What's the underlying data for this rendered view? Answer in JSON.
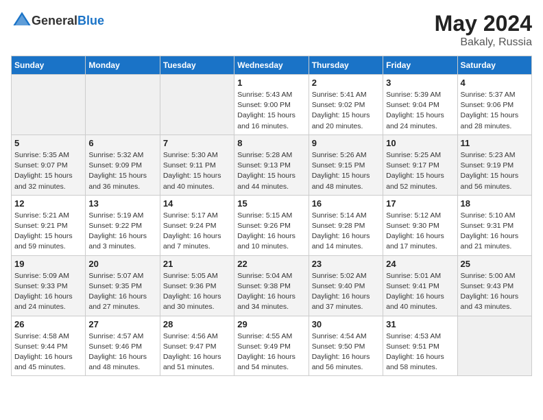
{
  "header": {
    "logo_general": "General",
    "logo_blue": "Blue",
    "month_year": "May 2024",
    "location": "Bakaly, Russia"
  },
  "weekdays": [
    "Sunday",
    "Monday",
    "Tuesday",
    "Wednesday",
    "Thursday",
    "Friday",
    "Saturday"
  ],
  "weeks": [
    [
      {
        "day": "",
        "info": ""
      },
      {
        "day": "",
        "info": ""
      },
      {
        "day": "",
        "info": ""
      },
      {
        "day": "1",
        "info": "Sunrise: 5:43 AM\nSunset: 9:00 PM\nDaylight: 15 hours\nand 16 minutes."
      },
      {
        "day": "2",
        "info": "Sunrise: 5:41 AM\nSunset: 9:02 PM\nDaylight: 15 hours\nand 20 minutes."
      },
      {
        "day": "3",
        "info": "Sunrise: 5:39 AM\nSunset: 9:04 PM\nDaylight: 15 hours\nand 24 minutes."
      },
      {
        "day": "4",
        "info": "Sunrise: 5:37 AM\nSunset: 9:06 PM\nDaylight: 15 hours\nand 28 minutes."
      }
    ],
    [
      {
        "day": "5",
        "info": "Sunrise: 5:35 AM\nSunset: 9:07 PM\nDaylight: 15 hours\nand 32 minutes."
      },
      {
        "day": "6",
        "info": "Sunrise: 5:32 AM\nSunset: 9:09 PM\nDaylight: 15 hours\nand 36 minutes."
      },
      {
        "day": "7",
        "info": "Sunrise: 5:30 AM\nSunset: 9:11 PM\nDaylight: 15 hours\nand 40 minutes."
      },
      {
        "day": "8",
        "info": "Sunrise: 5:28 AM\nSunset: 9:13 PM\nDaylight: 15 hours\nand 44 minutes."
      },
      {
        "day": "9",
        "info": "Sunrise: 5:26 AM\nSunset: 9:15 PM\nDaylight: 15 hours\nand 48 minutes."
      },
      {
        "day": "10",
        "info": "Sunrise: 5:25 AM\nSunset: 9:17 PM\nDaylight: 15 hours\nand 52 minutes."
      },
      {
        "day": "11",
        "info": "Sunrise: 5:23 AM\nSunset: 9:19 PM\nDaylight: 15 hours\nand 56 minutes."
      }
    ],
    [
      {
        "day": "12",
        "info": "Sunrise: 5:21 AM\nSunset: 9:21 PM\nDaylight: 15 hours\nand 59 minutes."
      },
      {
        "day": "13",
        "info": "Sunrise: 5:19 AM\nSunset: 9:22 PM\nDaylight: 16 hours\nand 3 minutes."
      },
      {
        "day": "14",
        "info": "Sunrise: 5:17 AM\nSunset: 9:24 PM\nDaylight: 16 hours\nand 7 minutes."
      },
      {
        "day": "15",
        "info": "Sunrise: 5:15 AM\nSunset: 9:26 PM\nDaylight: 16 hours\nand 10 minutes."
      },
      {
        "day": "16",
        "info": "Sunrise: 5:14 AM\nSunset: 9:28 PM\nDaylight: 16 hours\nand 14 minutes."
      },
      {
        "day": "17",
        "info": "Sunrise: 5:12 AM\nSunset: 9:30 PM\nDaylight: 16 hours\nand 17 minutes."
      },
      {
        "day": "18",
        "info": "Sunrise: 5:10 AM\nSunset: 9:31 PM\nDaylight: 16 hours\nand 21 minutes."
      }
    ],
    [
      {
        "day": "19",
        "info": "Sunrise: 5:09 AM\nSunset: 9:33 PM\nDaylight: 16 hours\nand 24 minutes."
      },
      {
        "day": "20",
        "info": "Sunrise: 5:07 AM\nSunset: 9:35 PM\nDaylight: 16 hours\nand 27 minutes."
      },
      {
        "day": "21",
        "info": "Sunrise: 5:05 AM\nSunset: 9:36 PM\nDaylight: 16 hours\nand 30 minutes."
      },
      {
        "day": "22",
        "info": "Sunrise: 5:04 AM\nSunset: 9:38 PM\nDaylight: 16 hours\nand 34 minutes."
      },
      {
        "day": "23",
        "info": "Sunrise: 5:02 AM\nSunset: 9:40 PM\nDaylight: 16 hours\nand 37 minutes."
      },
      {
        "day": "24",
        "info": "Sunrise: 5:01 AM\nSunset: 9:41 PM\nDaylight: 16 hours\nand 40 minutes."
      },
      {
        "day": "25",
        "info": "Sunrise: 5:00 AM\nSunset: 9:43 PM\nDaylight: 16 hours\nand 43 minutes."
      }
    ],
    [
      {
        "day": "26",
        "info": "Sunrise: 4:58 AM\nSunset: 9:44 PM\nDaylight: 16 hours\nand 45 minutes."
      },
      {
        "day": "27",
        "info": "Sunrise: 4:57 AM\nSunset: 9:46 PM\nDaylight: 16 hours\nand 48 minutes."
      },
      {
        "day": "28",
        "info": "Sunrise: 4:56 AM\nSunset: 9:47 PM\nDaylight: 16 hours\nand 51 minutes."
      },
      {
        "day": "29",
        "info": "Sunrise: 4:55 AM\nSunset: 9:49 PM\nDaylight: 16 hours\nand 54 minutes."
      },
      {
        "day": "30",
        "info": "Sunrise: 4:54 AM\nSunset: 9:50 PM\nDaylight: 16 hours\nand 56 minutes."
      },
      {
        "day": "31",
        "info": "Sunrise: 4:53 AM\nSunset: 9:51 PM\nDaylight: 16 hours\nand 58 minutes."
      },
      {
        "day": "",
        "info": ""
      }
    ]
  ]
}
